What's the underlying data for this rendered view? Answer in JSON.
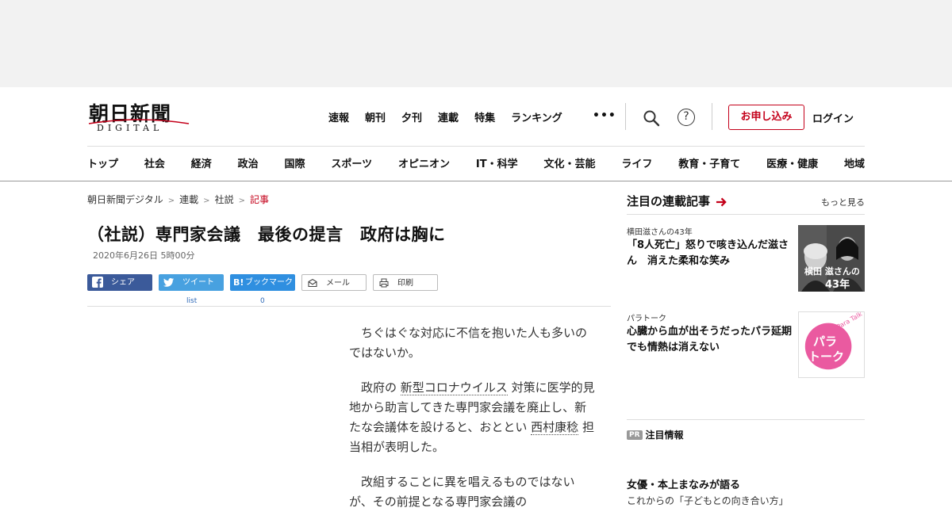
{
  "header": {
    "logo_main": "朝日新聞",
    "logo_sub": "DIGITAL",
    "top_nav": [
      "速報",
      "朝刊",
      "夕刊",
      "連載",
      "特集",
      "ランキング"
    ],
    "more": "•••",
    "signup": "お申し込み",
    "login": "ログイン",
    "categories": [
      "トップ",
      "社会",
      "経済",
      "政治",
      "国際",
      "スポーツ",
      "オピニオン",
      "IT・科学",
      "文化・芸能",
      "ライフ",
      "教育・子育て",
      "医療・健康",
      "地域"
    ],
    "accent_color": "#c4001a"
  },
  "breadcrumb": {
    "items": [
      "朝日新聞デジタル",
      "連載",
      "社説"
    ],
    "current": "記事",
    "sep": ">"
  },
  "article": {
    "title": "（社説）専門家会議　最後の提言　政府は胸に",
    "date": "2020年6月26日 5時00分",
    "share": {
      "facebook": "シェア",
      "twitter": "ツイート",
      "twitter_count": "list",
      "hatena": "ブックマーク",
      "hatena_count": "0",
      "mail": "メール",
      "print": "印刷"
    },
    "para1": "ちぐはぐな対応に不信を抱いた人も多いのではないか。",
    "para2_a": "政府の ",
    "para2_kw1": "新型コロナウイルス",
    "para2_b": " 対策に医学的見地から助言してきた専門家会議を廃止し、新たな会議体を設けると、おととい ",
    "para2_kw2": "西村康稔",
    "para2_c": " 担当相が表明した。",
    "para3": "改組することに異を唱えるものではないが、その前提となる専門家会議の"
  },
  "sidebar": {
    "heading": "注目の連載記事",
    "more": "もっと見る",
    "card1_kicker": "横田滋さんの43年",
    "card1_title": "「8人死亡」怒りで咳き込んだ滋さん　消えた柔和な笑み",
    "card1_thumb_text": "横田 滋さんの",
    "card1_thumb_num": "43年",
    "card2_kicker": "パラトーク",
    "card2_title": "心臓から血が出そうだったパラ延期　でも情熱は消えない",
    "card2_thumb_line1": "パラ",
    "card2_thumb_line2": "トーク",
    "card2_thumb_en": "Para Talk",
    "pr_badge": "PR",
    "pr_label": "注目情報",
    "promo_title": "女優・本上まなみが語る",
    "promo_sub": "これからの「子どもとの向き合い方」"
  }
}
